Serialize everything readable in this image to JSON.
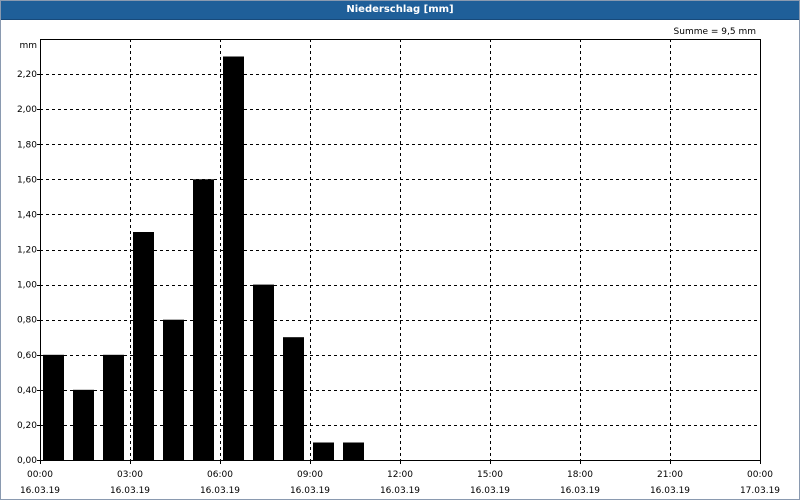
{
  "window": {
    "title": "Niederschlag [mm]"
  },
  "chart_data": {
    "type": "bar",
    "title": "",
    "ylabel": "mm",
    "xlabel": "",
    "annotation": "Summe = 9,5 mm",
    "ylim": [
      0,
      2.4
    ],
    "y_ticks": [
      0,
      0.2,
      0.4,
      0.6,
      0.8,
      1.0,
      1.2,
      1.4,
      1.6,
      1.8,
      2.0,
      2.2
    ],
    "y_tick_labels": [
      "0,00",
      "0,20",
      "0,40",
      "0,60",
      "0,80",
      "1,00",
      "1,20",
      "1,40",
      "1,60",
      "1,80",
      "2,00",
      "2,20"
    ],
    "x_range_hours": [
      0,
      24
    ],
    "x_ticks_hours": [
      0,
      3,
      6,
      9,
      12,
      15,
      18,
      21,
      24
    ],
    "x_tick_time_labels": [
      "00:00",
      "03:00",
      "06:00",
      "09:00",
      "12:00",
      "15:00",
      "18:00",
      "21:00",
      "00:00"
    ],
    "x_tick_date_labels": [
      "16.03.19",
      "16.03.19",
      "16.03.19",
      "16.03.19",
      "16.03.19",
      "16.03.19",
      "16.03.19",
      "16.03.19",
      "17.03.19"
    ],
    "bar_interval_hours": 1,
    "bar_start_hours": [
      0,
      1,
      2,
      3,
      4,
      5,
      6,
      7,
      8,
      9,
      10
    ],
    "values": [
      0.6,
      0.4,
      0.6,
      1.3,
      0.8,
      1.6,
      2.3,
      1.0,
      0.7,
      0.1,
      0.1
    ],
    "bar_color": "#000000",
    "grid": true,
    "grid_style": "dashed"
  }
}
